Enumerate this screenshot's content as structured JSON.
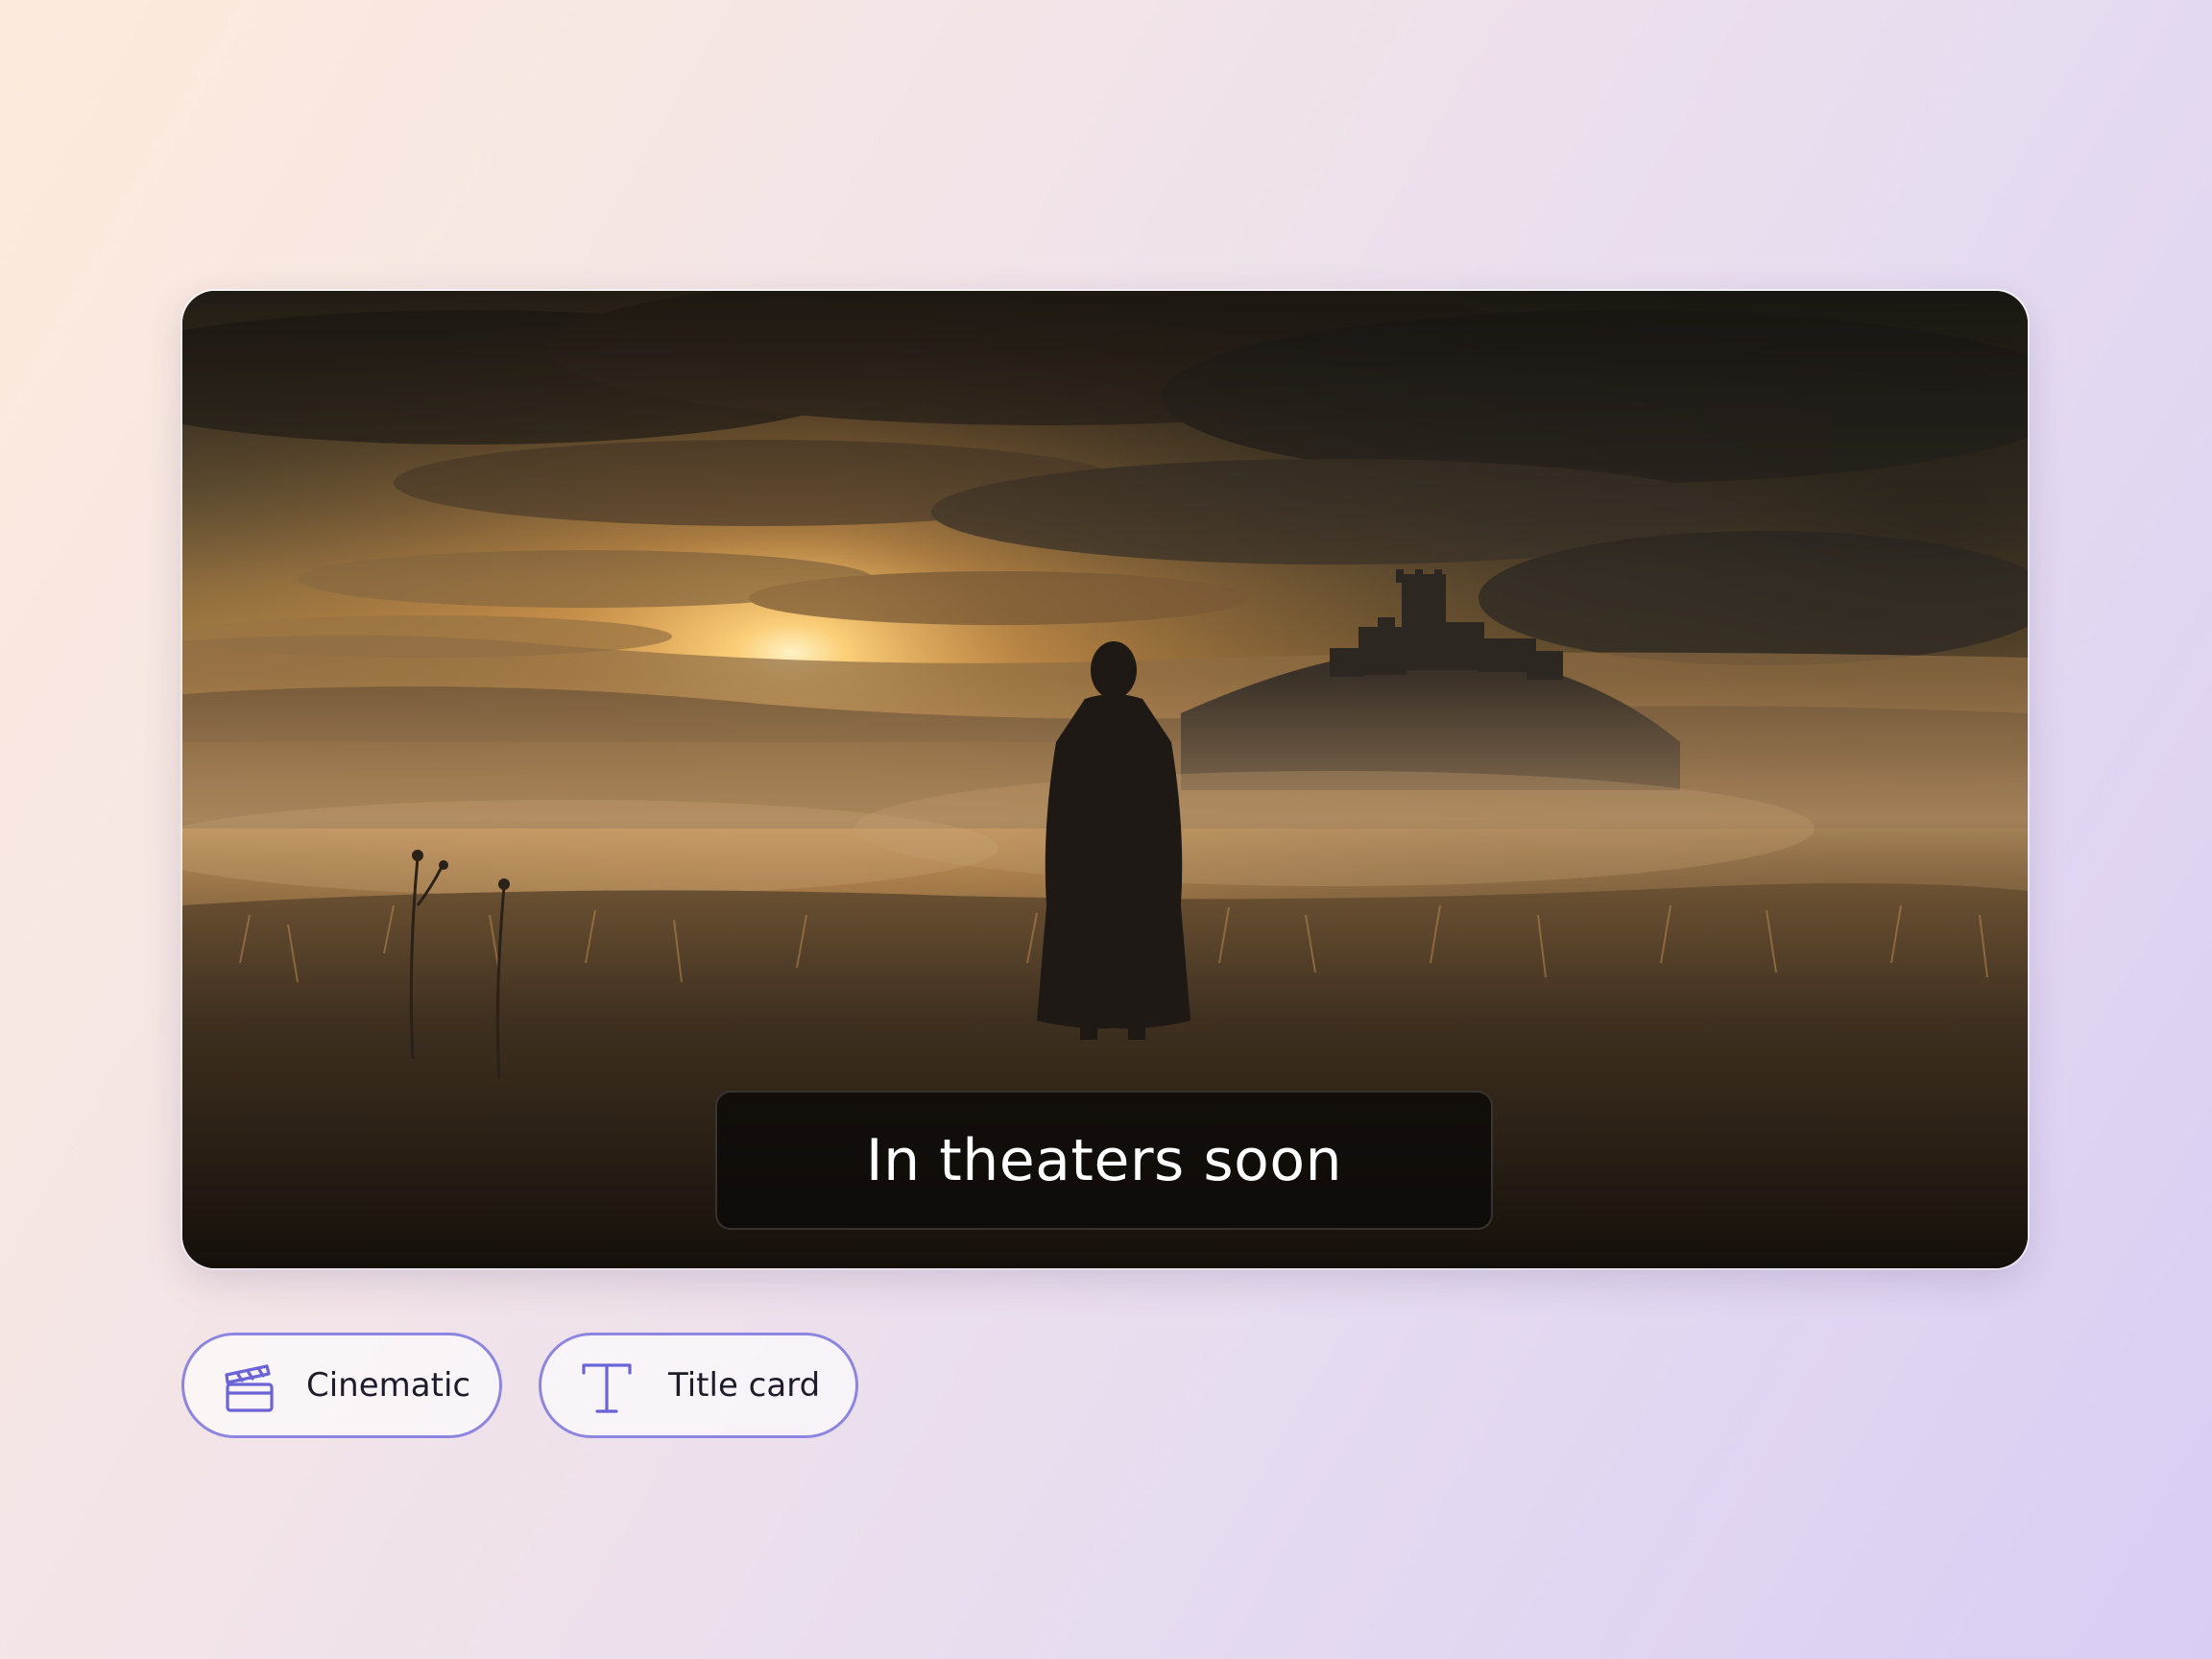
{
  "preview": {
    "image_description_icon": "cinematic-landscape-image",
    "caption": "In theaters soon"
  },
  "chips": {
    "cinematic": {
      "label": "Cinematic",
      "icon": "clapperboard-icon"
    },
    "title_card": {
      "label": "Title card",
      "icon": "text-t-icon"
    }
  },
  "colors": {
    "chip_border": "#8d86e0",
    "chip_icon": "#6b64d6",
    "caption_bg": "#0e0b08",
    "caption_text": "#ffffff"
  }
}
